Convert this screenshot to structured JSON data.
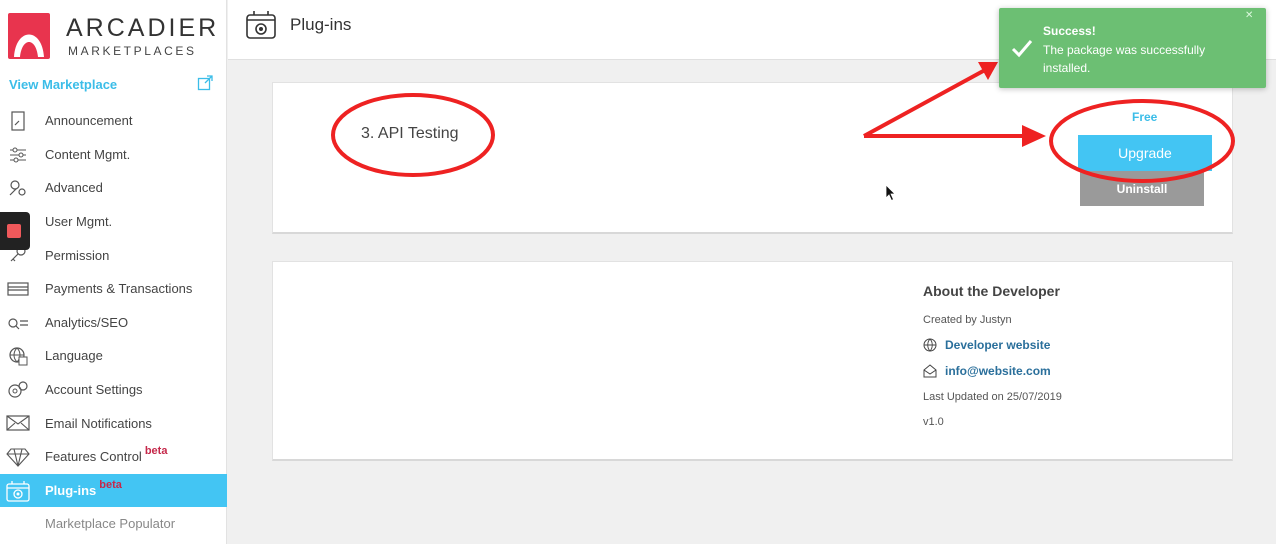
{
  "brand": {
    "title": "ARCADIER",
    "subtitle": "MARKETPLACES"
  },
  "sidebar": {
    "view_marketplace": "View Marketplace",
    "items": [
      {
        "label": "Announcement",
        "icon": "announcement-icon"
      },
      {
        "label": "Content Mgmt.",
        "icon": "sliders-icon"
      },
      {
        "label": "Advanced",
        "icon": "advanced-icon"
      },
      {
        "label": "User Mgmt.",
        "icon": "user-icon"
      },
      {
        "label": "Permission",
        "icon": "key-icon"
      },
      {
        "label": "Payments & Transactions",
        "icon": "card-icon"
      },
      {
        "label": "Analytics/SEO",
        "icon": "analytics-icon"
      },
      {
        "label": "Language",
        "icon": "globe-icon"
      },
      {
        "label": "Account Settings",
        "icon": "gears-icon"
      },
      {
        "label": "Email Notifications",
        "icon": "mail-icon"
      },
      {
        "label": "Features Control",
        "badge": "beta",
        "icon": "diamond-icon"
      },
      {
        "label": "Plug-ins",
        "badge": "beta",
        "icon": "plugin-icon",
        "active": true
      },
      {
        "label": "Marketplace Populator",
        "sub": true
      }
    ]
  },
  "header": {
    "title": "Plug-ins"
  },
  "plugin": {
    "name": "3. API Testing",
    "price": "Free",
    "upgrade_label": "Upgrade",
    "uninstall_label": "Uninstall"
  },
  "developer": {
    "heading": "About the Developer",
    "created_by": "Created by Justyn",
    "website_label": "Developer website",
    "email": "info@website.com",
    "last_updated": "Last Updated on 25/07/2019",
    "version": "v1.0"
  },
  "toast": {
    "title": "Success!",
    "message": "The package was successfully installed.",
    "close": "✕"
  },
  "colors": {
    "accent": "#43c5f3",
    "success": "#6cbf73",
    "annotation": "#ee2222",
    "beta": "#c5284a"
  }
}
